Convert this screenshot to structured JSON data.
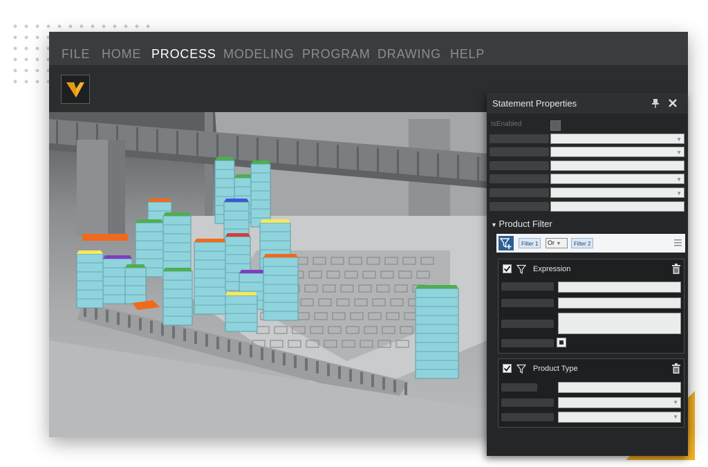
{
  "menu": {
    "items": [
      {
        "label": "FILE",
        "active": false
      },
      {
        "label": "HOME",
        "active": false
      },
      {
        "label": "PROCESS",
        "active": true
      },
      {
        "label": "MODELING",
        "active": false
      },
      {
        "label": "PROGRAM",
        "active": false
      },
      {
        "label": "DRAWING",
        "active": false
      },
      {
        "label": "HELP",
        "active": false
      }
    ]
  },
  "logo": {
    "icon": "visual-components-logo",
    "accent_color": "#f5b026"
  },
  "viewport": {
    "description_icon": "3d-scene-conveyor-stacked-crates",
    "crate_color": "#8fd3dc",
    "lid_colors": [
      "#4caf50",
      "#f06a1d",
      "#f3ea5a",
      "#7d3fbd",
      "#3b59d4",
      "#d63b3b"
    ]
  },
  "panel": {
    "title": "Statement Properties",
    "pin_icon": "pin-icon",
    "close_icon": "close-icon",
    "is_enabled_label": "IsEnabled",
    "product_filter": {
      "section_title": "Product Filter",
      "chips": [
        "Filter 1",
        "Filter 2"
      ],
      "operator": "Or",
      "cards": [
        {
          "title": "Expression"
        },
        {
          "title": "Product Type"
        }
      ]
    }
  }
}
